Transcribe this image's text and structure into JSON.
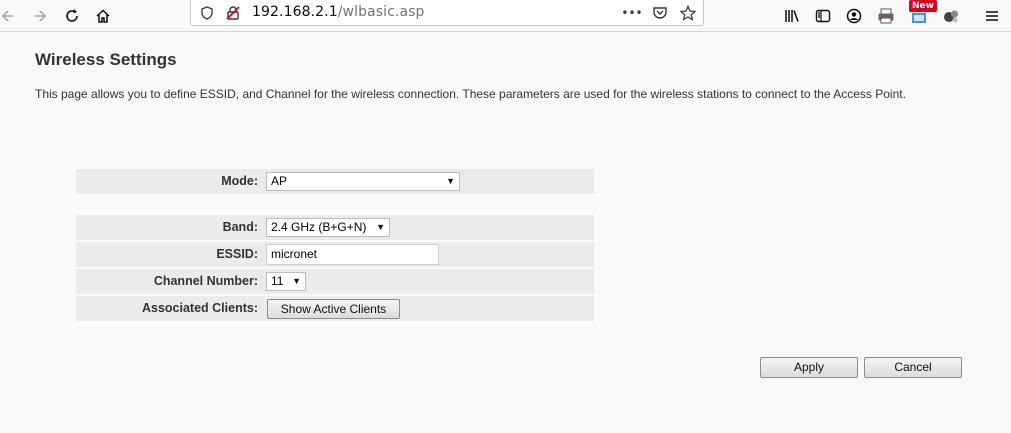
{
  "browser": {
    "url_host": "192.168.2.1",
    "url_path": "/wlbasic.asp",
    "more_icon_text": "•••",
    "new_badge": "New"
  },
  "page": {
    "title": "Wireless Settings",
    "description": "This page allows you to define ESSID, and Channel for the wireless connection. These parameters are used for the wireless stations to connect to the Access Point."
  },
  "form": {
    "mode": {
      "label": "Mode:",
      "value": "AP"
    },
    "band": {
      "label": "Band:",
      "value": "2.4 GHz (B+G+N)"
    },
    "essid": {
      "label": "ESSID:",
      "value": "micronet"
    },
    "channel": {
      "label": "Channel Number:",
      "value": "11"
    },
    "clients": {
      "label": "Associated Clients:",
      "button": "Show Active Clients"
    }
  },
  "actions": {
    "apply": "Apply",
    "cancel": "Cancel"
  }
}
